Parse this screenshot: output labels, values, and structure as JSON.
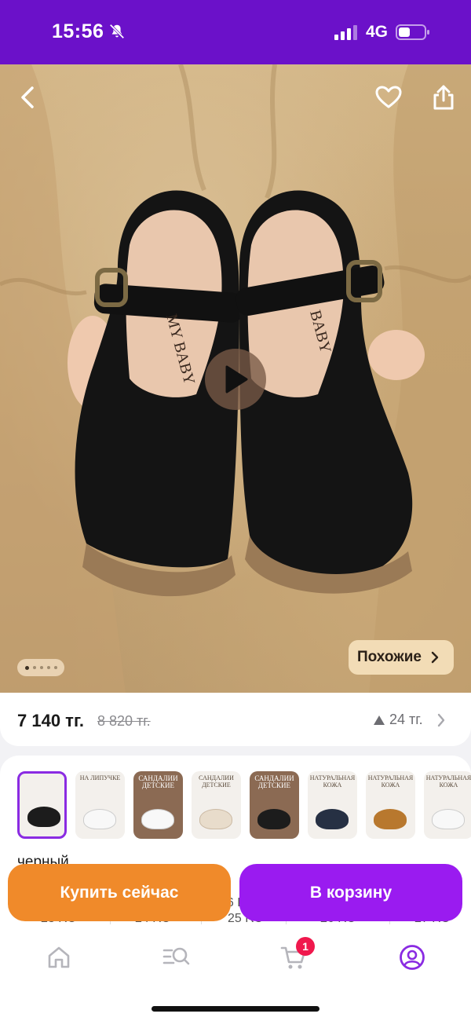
{
  "status_bar": {
    "time": "15:56",
    "network": "4G",
    "icons": [
      "bell-off-icon",
      "signal-icon",
      "battery-icon"
    ]
  },
  "hero": {
    "icons": [
      "chevron-left-icon",
      "heart-icon",
      "share-icon",
      "play-icon"
    ],
    "similar_label": "Похожие",
    "gallery_count": 5,
    "gallery_active_index": 0
  },
  "price": {
    "current": "7 140 тг.",
    "old": "8 820 тг.",
    "change": "24 тг."
  },
  "variants": {
    "thumbnails": [
      {
        "caption": "",
        "selected": true
      },
      {
        "caption": "НА ЛИПУЧКЕ",
        "selected": false
      },
      {
        "caption": "САНДАЛИИ ДЕТСКИЕ",
        "selected": false
      },
      {
        "caption": "САНДАЛИИ ДЕТСКИЕ",
        "selected": false
      },
      {
        "caption": "САНДАЛИИ ДЕТСКИЕ",
        "selected": false
      },
      {
        "caption": "НАТУРАЛЬНАЯ КОЖА",
        "selected": false
      },
      {
        "caption": "НАТУРАЛЬНАЯ КОЖА",
        "selected": false
      },
      {
        "caption": "НАТУРАЛЬНАЯ КОЖА",
        "selected": false
      }
    ],
    "color_label": "черный",
    "sizes": [
      "23 RU",
      "24 RU",
      "25 RU",
      "26 RU",
      "27 RU"
    ],
    "partial_size_text": "26 E"
  },
  "actions": {
    "buy_now": "Купить сейчас",
    "add_to_cart": "В корзину"
  },
  "bottom_nav": {
    "items": [
      "home-icon",
      "catalog-search-icon",
      "cart-icon",
      "profile-icon"
    ],
    "active": "profile-icon",
    "cart_badge": "1"
  },
  "colors": {
    "status_bar": "#6b11c9",
    "buy_button": "#f08a2a",
    "cart_button": "#9a1bf0",
    "accent": "#8a2be2",
    "badge": "#f0184d"
  }
}
